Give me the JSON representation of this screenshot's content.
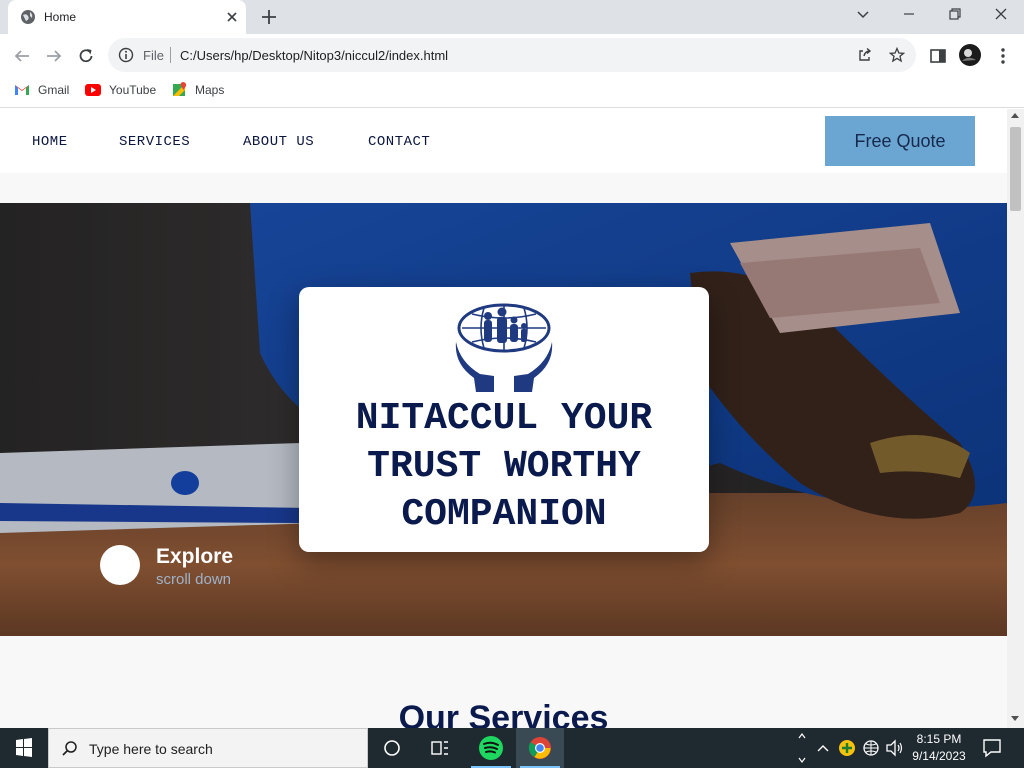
{
  "browser": {
    "tab": {
      "title": "Home"
    },
    "address": {
      "scheme": "File",
      "url": "C:/Users/hp/Desktop/Nitop3/niccul2/index.html"
    },
    "bookmarks": [
      {
        "label": "Gmail",
        "icon": "gmail-icon"
      },
      {
        "label": "YouTube",
        "icon": "youtube-icon"
      },
      {
        "label": "Maps",
        "icon": "maps-icon"
      }
    ]
  },
  "site": {
    "nav": [
      "HOME",
      "SERVICES",
      "ABOUT US",
      "CONTACT"
    ],
    "cta": "Free Quote",
    "hero": {
      "headline": "NITACCUL YOUR TRUST WORTHY COMPANION",
      "explore_title": "Explore",
      "explore_sub": "scroll down"
    },
    "services_heading": "Our Services"
  },
  "taskbar": {
    "search_placeholder": "Type here to search",
    "time": "8:15 PM",
    "date": "9/14/2023"
  },
  "colors": {
    "navy": "#0a1a4d",
    "cta_bg": "#6aa6d1",
    "taskbar_bg": "#1e2930"
  }
}
